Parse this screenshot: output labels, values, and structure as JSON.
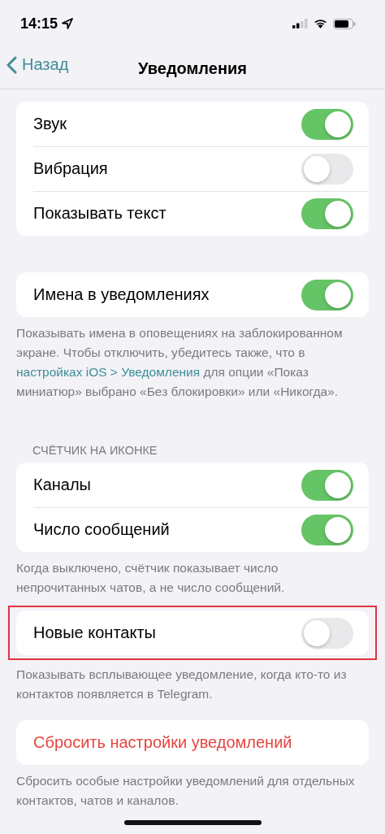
{
  "status_bar": {
    "time": "14:15"
  },
  "nav": {
    "back": "Назад",
    "title": "Уведомления"
  },
  "sections": [
    {
      "rows": [
        {
          "kind": "toggle",
          "label": "Звук",
          "on": true
        },
        {
          "kind": "toggle",
          "label": "Вибрация",
          "on": false
        },
        {
          "kind": "toggle",
          "label": "Показывать текст",
          "on": true
        }
      ]
    },
    {
      "rows": [
        {
          "kind": "toggle",
          "label": "Имена в уведомлениях",
          "on": true
        }
      ],
      "footer": {
        "before": "Показывать имена в оповещениях на заблокированном экране. Чтобы отключить, убедитесь также, что в ",
        "link": "настройках iOS > Уведомления",
        "after": " для опции «Показ миниатюр» выбрано «Без блокировки» или «Никогда»."
      }
    },
    {
      "header": "СЧЁТЧИК НА ИКОНКЕ",
      "rows": [
        {
          "kind": "toggle",
          "label": "Каналы",
          "on": true
        },
        {
          "kind": "toggle",
          "label": "Число сообщений",
          "on": true
        }
      ],
      "footer": {
        "before": "Когда выключено, счётчик показывает число непрочитанных чатов, а не число сообщений."
      }
    },
    {
      "highlighted": true,
      "rows": [
        {
          "kind": "toggle",
          "label": "Новые контакты",
          "on": false
        }
      ],
      "footer": {
        "before": "Показывать всплывающее уведомление, когда кто-то из контактов появляется в Telegram."
      }
    },
    {
      "rows": [
        {
          "kind": "action",
          "label": "Сбросить настройки уведомлений"
        }
      ],
      "footer": {
        "before": "Сбросить особые настройки уведомлений для отдельных контактов, чатов и каналов."
      }
    }
  ]
}
